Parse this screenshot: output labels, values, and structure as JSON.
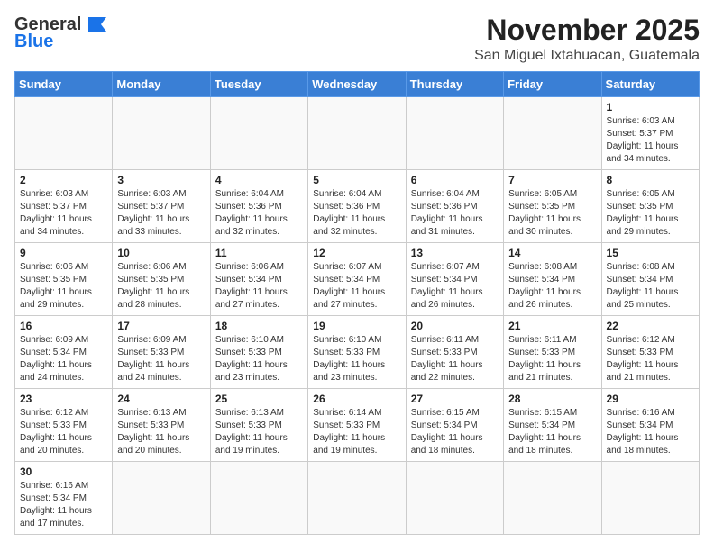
{
  "header": {
    "logo_line1": "General",
    "logo_line2": "Blue",
    "month_title": "November 2025",
    "location": "San Miguel Ixtahuacan, Guatemala"
  },
  "days_of_week": [
    "Sunday",
    "Monday",
    "Tuesday",
    "Wednesday",
    "Thursday",
    "Friday",
    "Saturday"
  ],
  "weeks": [
    [
      {
        "day": "",
        "info": ""
      },
      {
        "day": "",
        "info": ""
      },
      {
        "day": "",
        "info": ""
      },
      {
        "day": "",
        "info": ""
      },
      {
        "day": "",
        "info": ""
      },
      {
        "day": "",
        "info": ""
      },
      {
        "day": "1",
        "info": "Sunrise: 6:03 AM\nSunset: 5:37 PM\nDaylight: 11 hours\nand 34 minutes."
      }
    ],
    [
      {
        "day": "2",
        "info": "Sunrise: 6:03 AM\nSunset: 5:37 PM\nDaylight: 11 hours\nand 34 minutes."
      },
      {
        "day": "3",
        "info": "Sunrise: 6:03 AM\nSunset: 5:37 PM\nDaylight: 11 hours\nand 33 minutes."
      },
      {
        "day": "4",
        "info": "Sunrise: 6:04 AM\nSunset: 5:36 PM\nDaylight: 11 hours\nand 32 minutes."
      },
      {
        "day": "5",
        "info": "Sunrise: 6:04 AM\nSunset: 5:36 PM\nDaylight: 11 hours\nand 32 minutes."
      },
      {
        "day": "6",
        "info": "Sunrise: 6:04 AM\nSunset: 5:36 PM\nDaylight: 11 hours\nand 31 minutes."
      },
      {
        "day": "7",
        "info": "Sunrise: 6:05 AM\nSunset: 5:35 PM\nDaylight: 11 hours\nand 30 minutes."
      },
      {
        "day": "8",
        "info": "Sunrise: 6:05 AM\nSunset: 5:35 PM\nDaylight: 11 hours\nand 29 minutes."
      }
    ],
    [
      {
        "day": "9",
        "info": "Sunrise: 6:06 AM\nSunset: 5:35 PM\nDaylight: 11 hours\nand 29 minutes."
      },
      {
        "day": "10",
        "info": "Sunrise: 6:06 AM\nSunset: 5:35 PM\nDaylight: 11 hours\nand 28 minutes."
      },
      {
        "day": "11",
        "info": "Sunrise: 6:06 AM\nSunset: 5:34 PM\nDaylight: 11 hours\nand 27 minutes."
      },
      {
        "day": "12",
        "info": "Sunrise: 6:07 AM\nSunset: 5:34 PM\nDaylight: 11 hours\nand 27 minutes."
      },
      {
        "day": "13",
        "info": "Sunrise: 6:07 AM\nSunset: 5:34 PM\nDaylight: 11 hours\nand 26 minutes."
      },
      {
        "day": "14",
        "info": "Sunrise: 6:08 AM\nSunset: 5:34 PM\nDaylight: 11 hours\nand 26 minutes."
      },
      {
        "day": "15",
        "info": "Sunrise: 6:08 AM\nSunset: 5:34 PM\nDaylight: 11 hours\nand 25 minutes."
      }
    ],
    [
      {
        "day": "16",
        "info": "Sunrise: 6:09 AM\nSunset: 5:34 PM\nDaylight: 11 hours\nand 24 minutes."
      },
      {
        "day": "17",
        "info": "Sunrise: 6:09 AM\nSunset: 5:33 PM\nDaylight: 11 hours\nand 24 minutes."
      },
      {
        "day": "18",
        "info": "Sunrise: 6:10 AM\nSunset: 5:33 PM\nDaylight: 11 hours\nand 23 minutes."
      },
      {
        "day": "19",
        "info": "Sunrise: 6:10 AM\nSunset: 5:33 PM\nDaylight: 11 hours\nand 23 minutes."
      },
      {
        "day": "20",
        "info": "Sunrise: 6:11 AM\nSunset: 5:33 PM\nDaylight: 11 hours\nand 22 minutes."
      },
      {
        "day": "21",
        "info": "Sunrise: 6:11 AM\nSunset: 5:33 PM\nDaylight: 11 hours\nand 21 minutes."
      },
      {
        "day": "22",
        "info": "Sunrise: 6:12 AM\nSunset: 5:33 PM\nDaylight: 11 hours\nand 21 minutes."
      }
    ],
    [
      {
        "day": "23",
        "info": "Sunrise: 6:12 AM\nSunset: 5:33 PM\nDaylight: 11 hours\nand 20 minutes."
      },
      {
        "day": "24",
        "info": "Sunrise: 6:13 AM\nSunset: 5:33 PM\nDaylight: 11 hours\nand 20 minutes."
      },
      {
        "day": "25",
        "info": "Sunrise: 6:13 AM\nSunset: 5:33 PM\nDaylight: 11 hours\nand 19 minutes."
      },
      {
        "day": "26",
        "info": "Sunrise: 6:14 AM\nSunset: 5:33 PM\nDaylight: 11 hours\nand 19 minutes."
      },
      {
        "day": "27",
        "info": "Sunrise: 6:15 AM\nSunset: 5:34 PM\nDaylight: 11 hours\nand 18 minutes."
      },
      {
        "day": "28",
        "info": "Sunrise: 6:15 AM\nSunset: 5:34 PM\nDaylight: 11 hours\nand 18 minutes."
      },
      {
        "day": "29",
        "info": "Sunrise: 6:16 AM\nSunset: 5:34 PM\nDaylight: 11 hours\nand 18 minutes."
      }
    ],
    [
      {
        "day": "30",
        "info": "Sunrise: 6:16 AM\nSunset: 5:34 PM\nDaylight: 11 hours\nand 17 minutes."
      },
      {
        "day": "",
        "info": ""
      },
      {
        "day": "",
        "info": ""
      },
      {
        "day": "",
        "info": ""
      },
      {
        "day": "",
        "info": ""
      },
      {
        "day": "",
        "info": ""
      },
      {
        "day": "",
        "info": ""
      }
    ]
  ]
}
